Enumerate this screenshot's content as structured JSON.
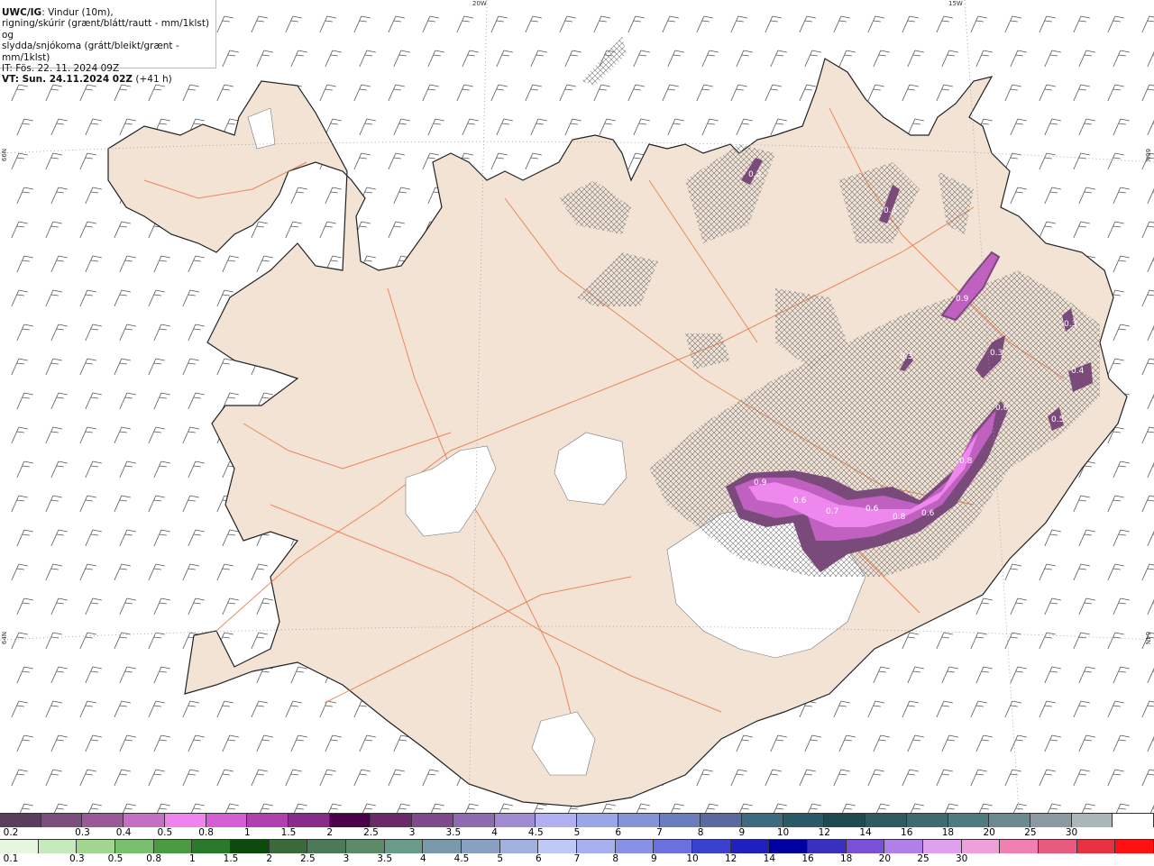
{
  "info": {
    "model": "UWC/IG",
    "line1_rest": ": Vindur (10m),",
    "line2": "rigning/skúrir (grænt/blátt/rautt - mm/1klst) og",
    "line3": "slydda/snjókoma (grátt/bleikt/grænt - mm/1klst)",
    "line4": "IT: Fös. 22. 11. 2024 09Z",
    "line5_bold": "VT: Sun. 24.11.2024 02Z",
    "line5_rest": " (+41 h)"
  },
  "grid_labels": {
    "lon_20w": "20W",
    "lon_15w": "15W",
    "lat_66n_left": "66N",
    "lat_66n_right": "66N",
    "lat_64n_left": "64N",
    "lat_64n_right": "64N"
  },
  "precip_labels": [
    {
      "text": "0.3",
      "name": "label-ne-a"
    },
    {
      "text": "0.4",
      "name": "label-ne-b"
    },
    {
      "text": "0.9",
      "name": "label-east-a"
    },
    {
      "text": "0.3",
      "name": "label-east-b"
    },
    {
      "text": "0.3",
      "name": "label-east-c"
    },
    {
      "text": "0.3",
      "name": "label-east-d"
    },
    {
      "text": "0.4",
      "name": "label-east-e"
    },
    {
      "text": "0.5",
      "name": "label-east-f"
    },
    {
      "text": "0.6",
      "name": "label-east-g"
    },
    {
      "text": "0.8",
      "name": "label-south-a"
    },
    {
      "text": "0.9",
      "name": "label-south-b"
    },
    {
      "text": "0.6",
      "name": "label-south-c"
    },
    {
      "text": "0.7",
      "name": "label-south-d"
    },
    {
      "text": "0.6",
      "name": "label-south-e"
    },
    {
      "text": "0.8",
      "name": "label-south-f"
    },
    {
      "text": "0.6",
      "name": "label-south-g"
    }
  ],
  "legend_top": {
    "colors": [
      "#5a3f5c",
      "#7a4f7c",
      "#9a5a9a",
      "#c46ec4",
      "#ef84ef",
      "#d45fd4",
      "#b040b0",
      "#8a2a8a",
      "#4a004a",
      "#6a2a6a",
      "#7e4a8c",
      "#8e6ab0",
      "#a08ad0",
      "#b0b0f0",
      "#9aa6e6",
      "#8494d4",
      "#6a7cbc",
      "#5a6aa0",
      "#3e6a80",
      "#2a5a66",
      "#1e4a50",
      "#2e5a60",
      "#3e6a70",
      "#4e7a80",
      "#6a8a90",
      "#8a9aa0",
      "#aab6b8",
      "#ffffff"
    ],
    "labels": [
      "0.2",
      "0.3",
      "0.4",
      "0.5",
      "0.8",
      "1",
      "1.5",
      "2",
      "2.5",
      "3",
      "3.5",
      "4",
      "4.5",
      "5",
      "6",
      "7",
      "8",
      "9",
      "10",
      "12",
      "14",
      "16",
      "18",
      "20",
      "25",
      "30"
    ]
  },
  "legend_bottom": {
    "colors": [
      "#e6f6e0",
      "#c6eabc",
      "#a0d690",
      "#78c070",
      "#4a9a40",
      "#2a7a2a",
      "#0a4a0a",
      "#3a6a3a",
      "#4a7a5a",
      "#5a8a6a",
      "#6a9a8a",
      "#7a9aaa",
      "#8aa0c0",
      "#a0b0e0",
      "#c0c8f8",
      "#a8b0f0",
      "#8890e8",
      "#6a70e0",
      "#3a40d0",
      "#2020c0",
      "#0000a0",
      "#3a30c0",
      "#7a50d8",
      "#b080e8",
      "#e0a0f0",
      "#f0a0d8",
      "#f080b0",
      "#e85a80",
      "#e83040",
      "#ff1010"
    ],
    "labels": [
      "0.1",
      "0.3",
      "0.5",
      "0.8",
      "1",
      "1.5",
      "2",
      "2.5",
      "3",
      "3.5",
      "4",
      "4.5",
      "5",
      "6",
      "7",
      "8",
      "9",
      "10",
      "12",
      "14",
      "16",
      "18",
      "20",
      "25",
      "30"
    ]
  },
  "colors": {
    "land": "#f2e3d5",
    "roads": "#e87040",
    "glacier": "#ffffff",
    "precip_light": "#7a4a7a",
    "precip_mid": "#c060c0",
    "precip_heavy": "#ee88ee"
  }
}
